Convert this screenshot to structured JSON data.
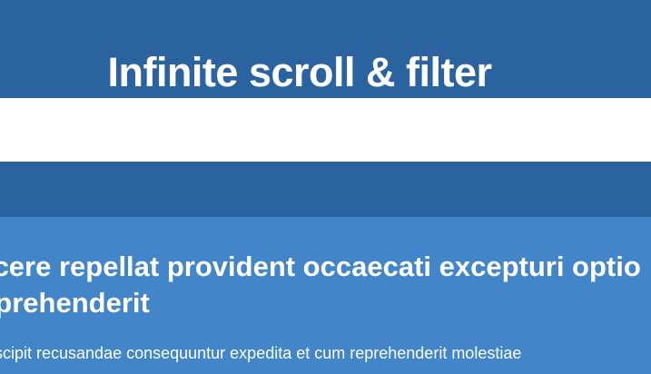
{
  "header": {
    "title": "Infinite scroll & filter"
  },
  "filter": {
    "value": "",
    "placeholder": ""
  },
  "posts": [
    {
      "title": "facere repellat provident occaecati excepturi optio reprehenderit",
      "body": "suscipit recusandae consequuntur expedita et cum reprehenderit molestiae"
    }
  ],
  "colors": {
    "page_background": "#2a63a0",
    "filter_background": "#ffffff",
    "post_background": "#4285c8",
    "text": "#ffffff"
  }
}
